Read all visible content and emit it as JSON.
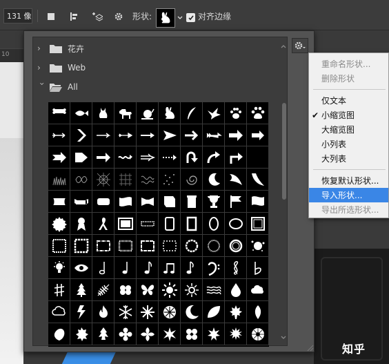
{
  "options_bar": {
    "size_value": "131 像",
    "shape_label": "形状:",
    "align_edges_label": "对齐边缘",
    "align_edges_checked": true
  },
  "ruler": {
    "value": "10"
  },
  "panel": {
    "folders": [
      {
        "label": "花卉",
        "expanded": false
      },
      {
        "label": "Web",
        "expanded": false
      },
      {
        "label": "All",
        "expanded": true
      }
    ],
    "shapes": [
      [
        "bone-icon",
        "fish-icon",
        "cat-icon",
        "dog-icon",
        "snail-icon",
        "rabbit-icon",
        "feather-icon",
        "dove-icon",
        "paw-print-icon",
        "paw-print-alt-icon"
      ],
      [
        "arrow-fletched-icon",
        "chevron-right-icon",
        "arrow-thin-icon",
        "arrow-feather-icon",
        "arrow-right-icon",
        "arrowhead-icon",
        "arrow-bold-icon",
        "arrow-fletch-icon",
        "arrow-block-icon",
        "arrow-solid-icon"
      ],
      [
        "arrow-tail-icon",
        "arrow-pentagon-icon",
        "arrow-heavy-icon",
        "wave-arrow-icon",
        "arrow-double-icon",
        "arrow-dotted-icon",
        "u-turn-arrow-icon",
        "curved-arrow-icon",
        "turn-arrow-icon",
        "blank"
      ],
      [
        "grass-texture-icon",
        "leaf-texture-icon",
        "web-texture-icon",
        "pattern-texture-icon",
        "scribble-texture-icon",
        "dots-texture-icon",
        "swirl-texture-icon",
        "moon-shape-icon",
        "wing-shape-icon",
        "curve-shape-icon"
      ],
      [
        "banner-icon",
        "ribbon-banner-icon",
        "badge-icon",
        "wavy-banner-icon",
        "bow-banner-icon",
        "scroll-banner-icon",
        "sign-banner-icon",
        "trophy-icon",
        "flag-icon",
        "waving-flag-icon"
      ],
      [
        "seal-icon",
        "award-ribbon-icon",
        "ribbon-icon",
        "film-frame-icon",
        "stamp-frame-icon",
        "frame-rect-icon",
        "frame-tall-icon",
        "frame-oval-icon",
        "frame-ornate-icon",
        "frame-corner-icon"
      ],
      [
        "frame-zigzag-icon",
        "frame-scalloped-icon",
        "frame-torn-icon",
        "frame-grunge-icon",
        "frame-distressed-icon",
        "frame-splatter-icon",
        "circle-grunge-icon",
        "circle-grain-icon",
        "circle-ring-icon",
        "ink-splat-icon"
      ],
      [
        "lightbulb-icon",
        "eye-icon",
        "music-note-quarter-icon",
        "music-note-eighth-icon",
        "music-note-icon",
        "beamed-notes-icon",
        "beamed-eighth-notes-icon",
        "bass-clef-icon",
        "treble-clef-icon",
        "flat-icon"
      ],
      [
        "sharp-icon",
        "tree-icon",
        "fern-icon",
        "clover-icon",
        "butterfly-icon",
        "sun-icon",
        "sun-rays-icon",
        "waves-icon",
        "raindrop-icon",
        "cloud-icon"
      ],
      [
        "speech-cloud-icon",
        "lightning-icon",
        "fire-icon",
        "snowflake-icon",
        "snowflake-alt-icon",
        "snowflake-round-icon",
        "crescent-moon-icon",
        "leaf-round-icon",
        "maple-leaf-icon",
        "leaf-pointed-icon"
      ],
      [
        "leaf-blob-icon",
        "maple-leaf-alt-icon",
        "tree-leaf-icon",
        "flower-icon",
        "flower-curl-icon",
        "flower-spiky-icon",
        "flower-heart-icon",
        "flower-star-icon",
        "flower-daisy-icon",
        "flower-round-icon"
      ]
    ]
  },
  "menu": {
    "items": [
      {
        "label": "重命名形状...",
        "disabled": true
      },
      {
        "label": "删除形状",
        "disabled": true
      },
      {
        "sep": true
      },
      {
        "label": "仅文本",
        "disabled": false
      },
      {
        "label": "小缩览图",
        "disabled": false,
        "checked": true
      },
      {
        "label": "大缩览图",
        "disabled": false
      },
      {
        "label": "小列表",
        "disabled": false
      },
      {
        "label": "大列表",
        "disabled": false
      },
      {
        "sep": true
      },
      {
        "label": "恢复默认形状...",
        "disabled": false
      },
      {
        "label": "导入形状...",
        "disabled": false,
        "highlighted": true
      },
      {
        "label": "导出所选形状...",
        "disabled": true
      }
    ]
  },
  "watermark": "知乎",
  "colors": {
    "highlight": "#3a86e6",
    "panel": "#535353",
    "grid_bg": "#000000"
  }
}
